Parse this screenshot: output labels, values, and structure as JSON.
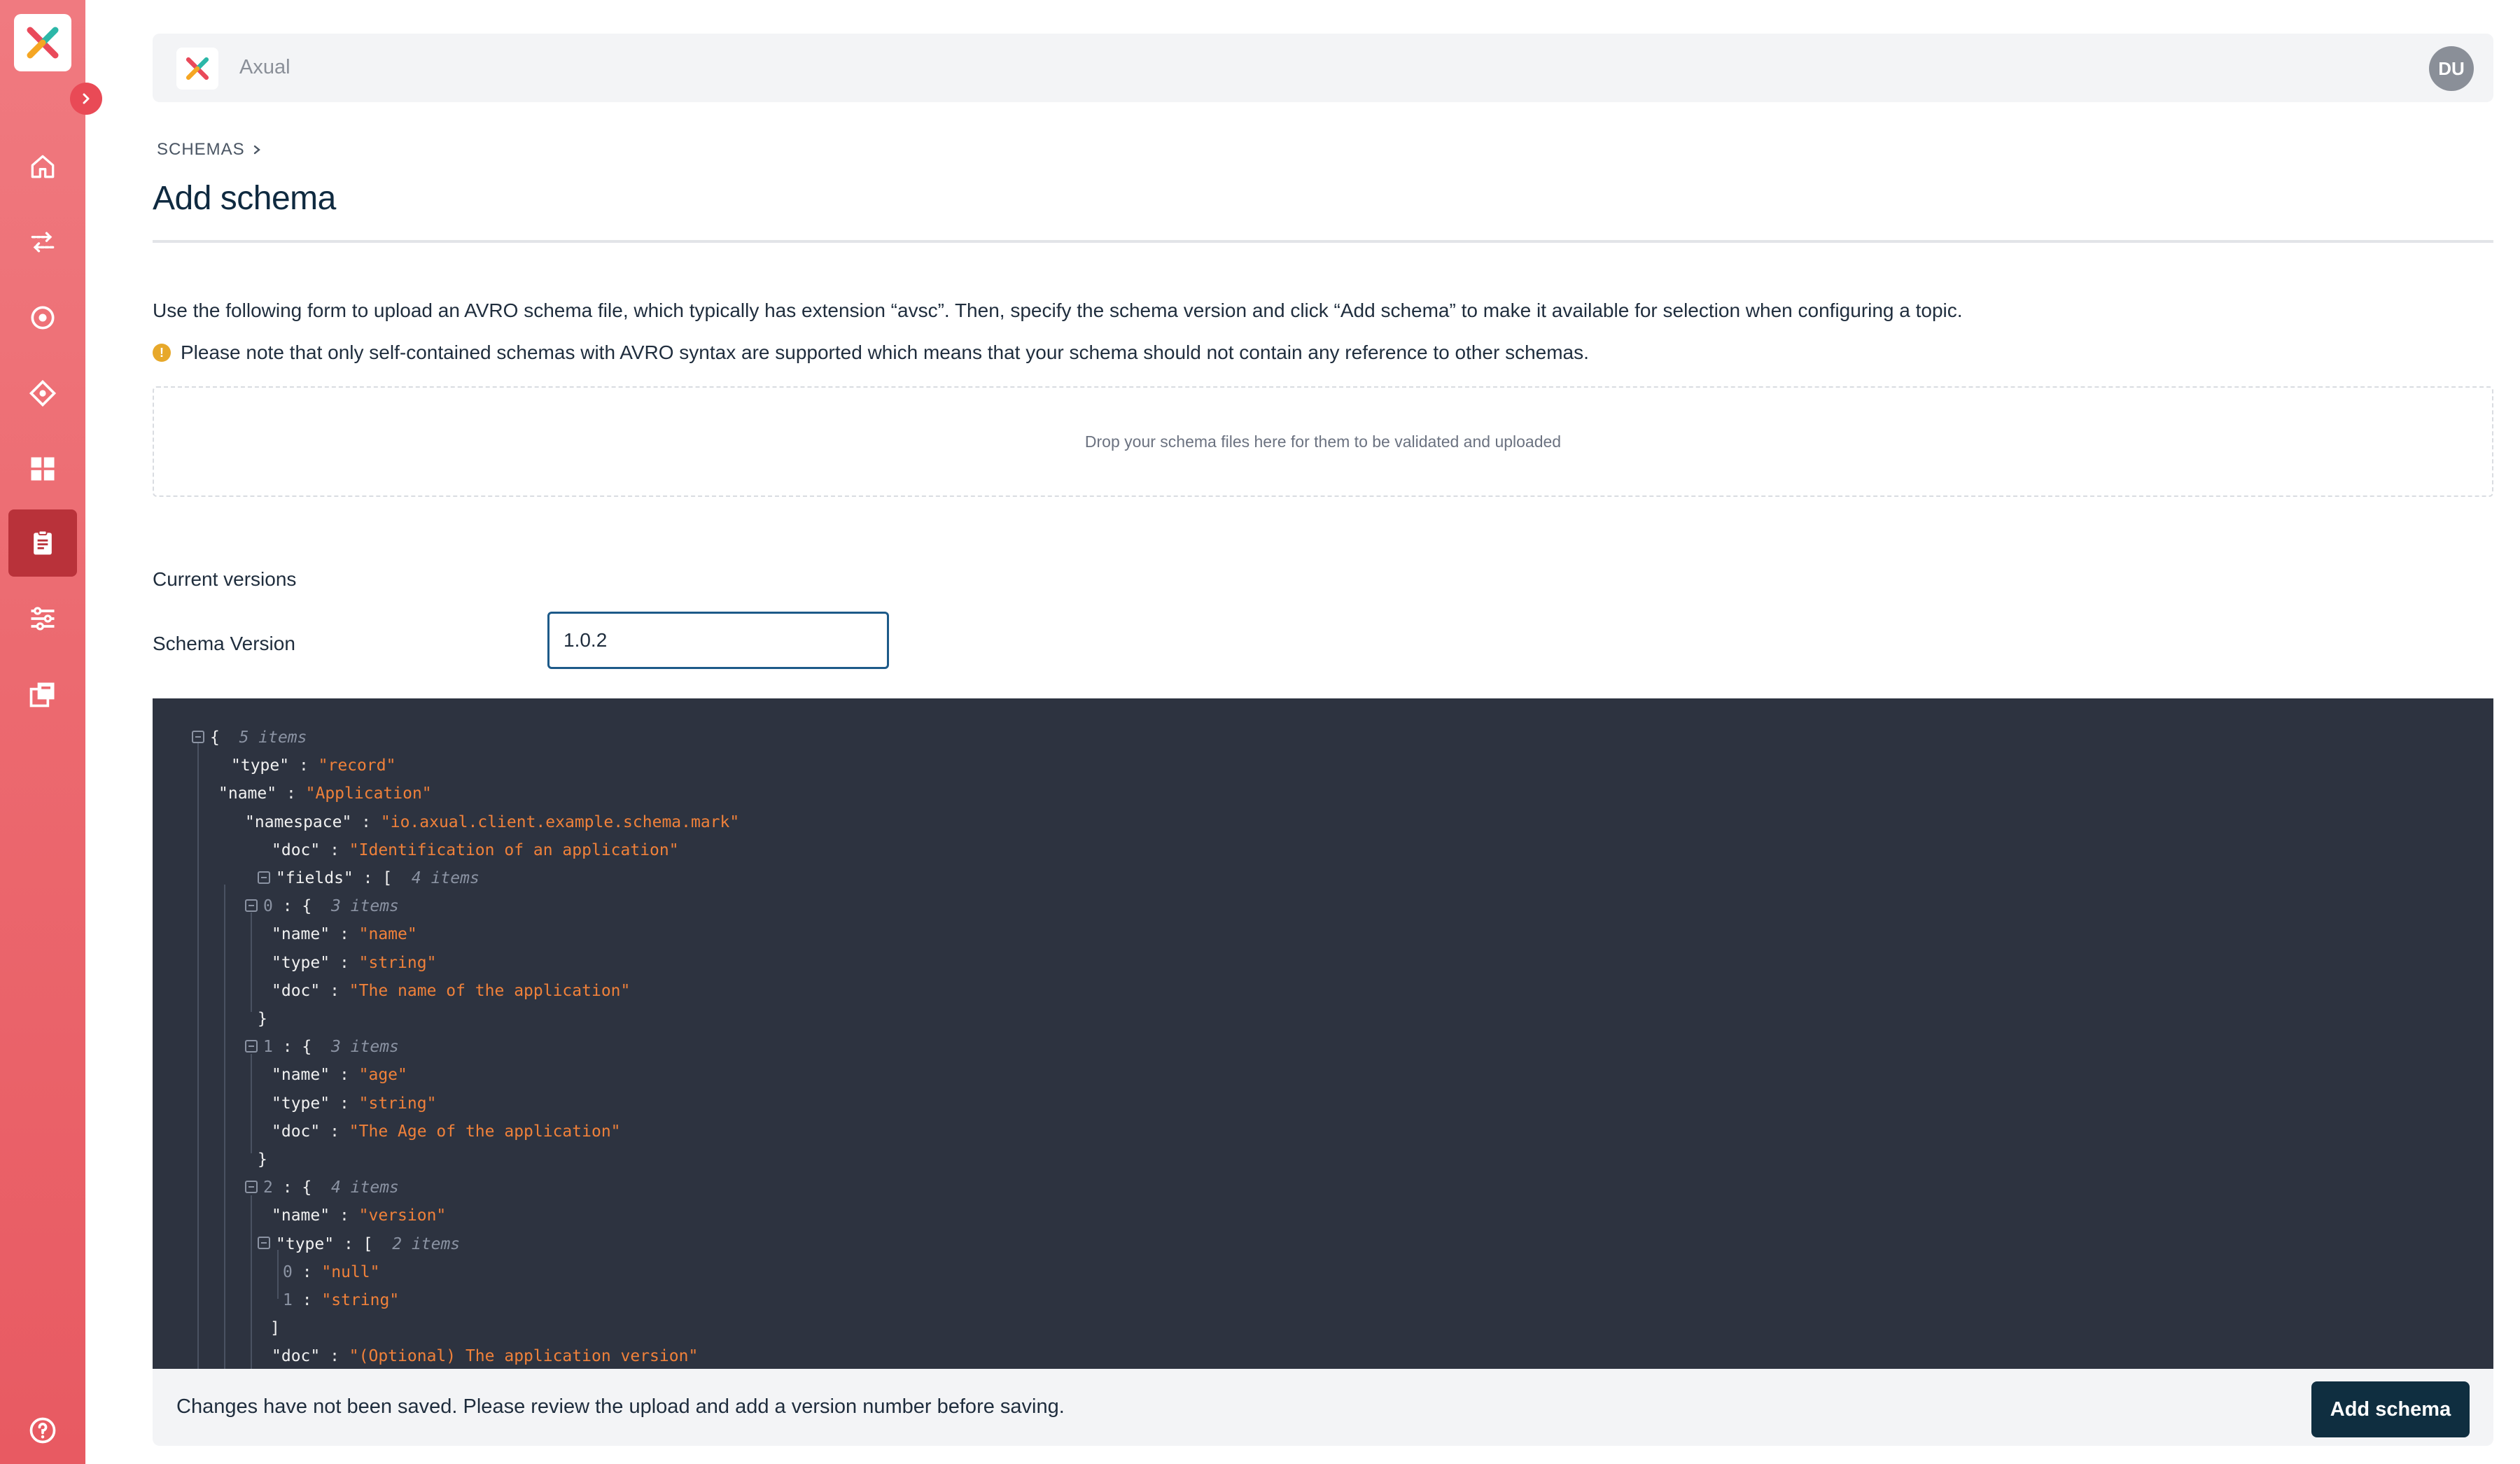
{
  "app": {
    "name": "Axual",
    "avatar_initials": "DU"
  },
  "sidebar": {
    "items": [
      {
        "icon": "home-icon"
      },
      {
        "icon": "streams-icon"
      },
      {
        "icon": "circle-target-icon"
      },
      {
        "icon": "diamond-connector-icon"
      },
      {
        "icon": "grid-dashboard-icon"
      },
      {
        "icon": "clipboard-schema-icon",
        "active": true
      },
      {
        "icon": "sliders-settings-icon"
      },
      {
        "icon": "copy-stack-icon"
      }
    ],
    "help_icon": "help-circle-icon"
  },
  "breadcrumb": {
    "section": "SCHEMAS"
  },
  "page": {
    "title": "Add schema",
    "intro": "Use the following form to upload an AVRO schema file, which typically has extension “avsc”. Then, specify the schema version and click “Add schema” to make it available for selection when configuring a topic.",
    "note": "Please note that only self-contained schemas with AVRO syntax are supported which means that your schema should not contain any reference to other schemas.",
    "dropzone": "Drop your schema files here for them to be validated and uploaded"
  },
  "form": {
    "current_versions_label": "Current versions",
    "schema_version_label": "Schema Version",
    "schema_version_value": "1.0.2"
  },
  "json_viewer": {
    "lines": [
      {
        "toggle": true,
        "open": "{",
        "info": "5 items"
      },
      {
        "key": "\"type\"",
        "value": "\"record\""
      },
      {
        "key": "\"name\"",
        "value": "\"Application\""
      },
      {
        "key": "\"namespace\"",
        "value": "\"io.axual.client.example.schema.mark\""
      },
      {
        "key": "\"doc\"",
        "value": "\"Identification of an application\""
      },
      {
        "toggle": true,
        "key": "\"fields\"",
        "open": "[",
        "info": "4 items"
      },
      {
        "toggle": true,
        "index": "0",
        "open": "{",
        "info": "3 items"
      },
      {
        "key": "\"name\"",
        "value": "\"name\""
      },
      {
        "key": "\"type\"",
        "value": "\"string\""
      },
      {
        "key": "\"doc\"",
        "value": "\"The name of the application\""
      },
      {
        "close": "}"
      },
      {
        "toggle": true,
        "index": "1",
        "open": "{",
        "info": "3 items"
      },
      {
        "key": "\"name\"",
        "value": "\"age\""
      },
      {
        "key": "\"type\"",
        "value": "\"string\""
      },
      {
        "key": "\"doc\"",
        "value": "\"The Age of the application\""
      },
      {
        "close": "}"
      },
      {
        "toggle": true,
        "index": "2",
        "open": "{",
        "info": "4 items"
      },
      {
        "key": "\"name\"",
        "value": "\"version\""
      },
      {
        "toggle": true,
        "key": "\"type\"",
        "open": "[",
        "info": "2 items"
      },
      {
        "index": "0",
        "value": "\"null\""
      },
      {
        "index": "1",
        "value": "\"string\""
      },
      {
        "close": "]"
      },
      {
        "key": "\"doc\"",
        "value": "\"(Optional) The application version\""
      }
    ]
  },
  "footer": {
    "message": "Changes have not been saved. Please review the upload and add a version number before saving.",
    "add_button": "Add schema"
  },
  "colors": {
    "sidebar": "#ec6a70",
    "sidebar_active": "#b9323a",
    "primary_button": "#0f2e40",
    "json_bg": "#2d3340",
    "json_string": "#f0813a"
  }
}
